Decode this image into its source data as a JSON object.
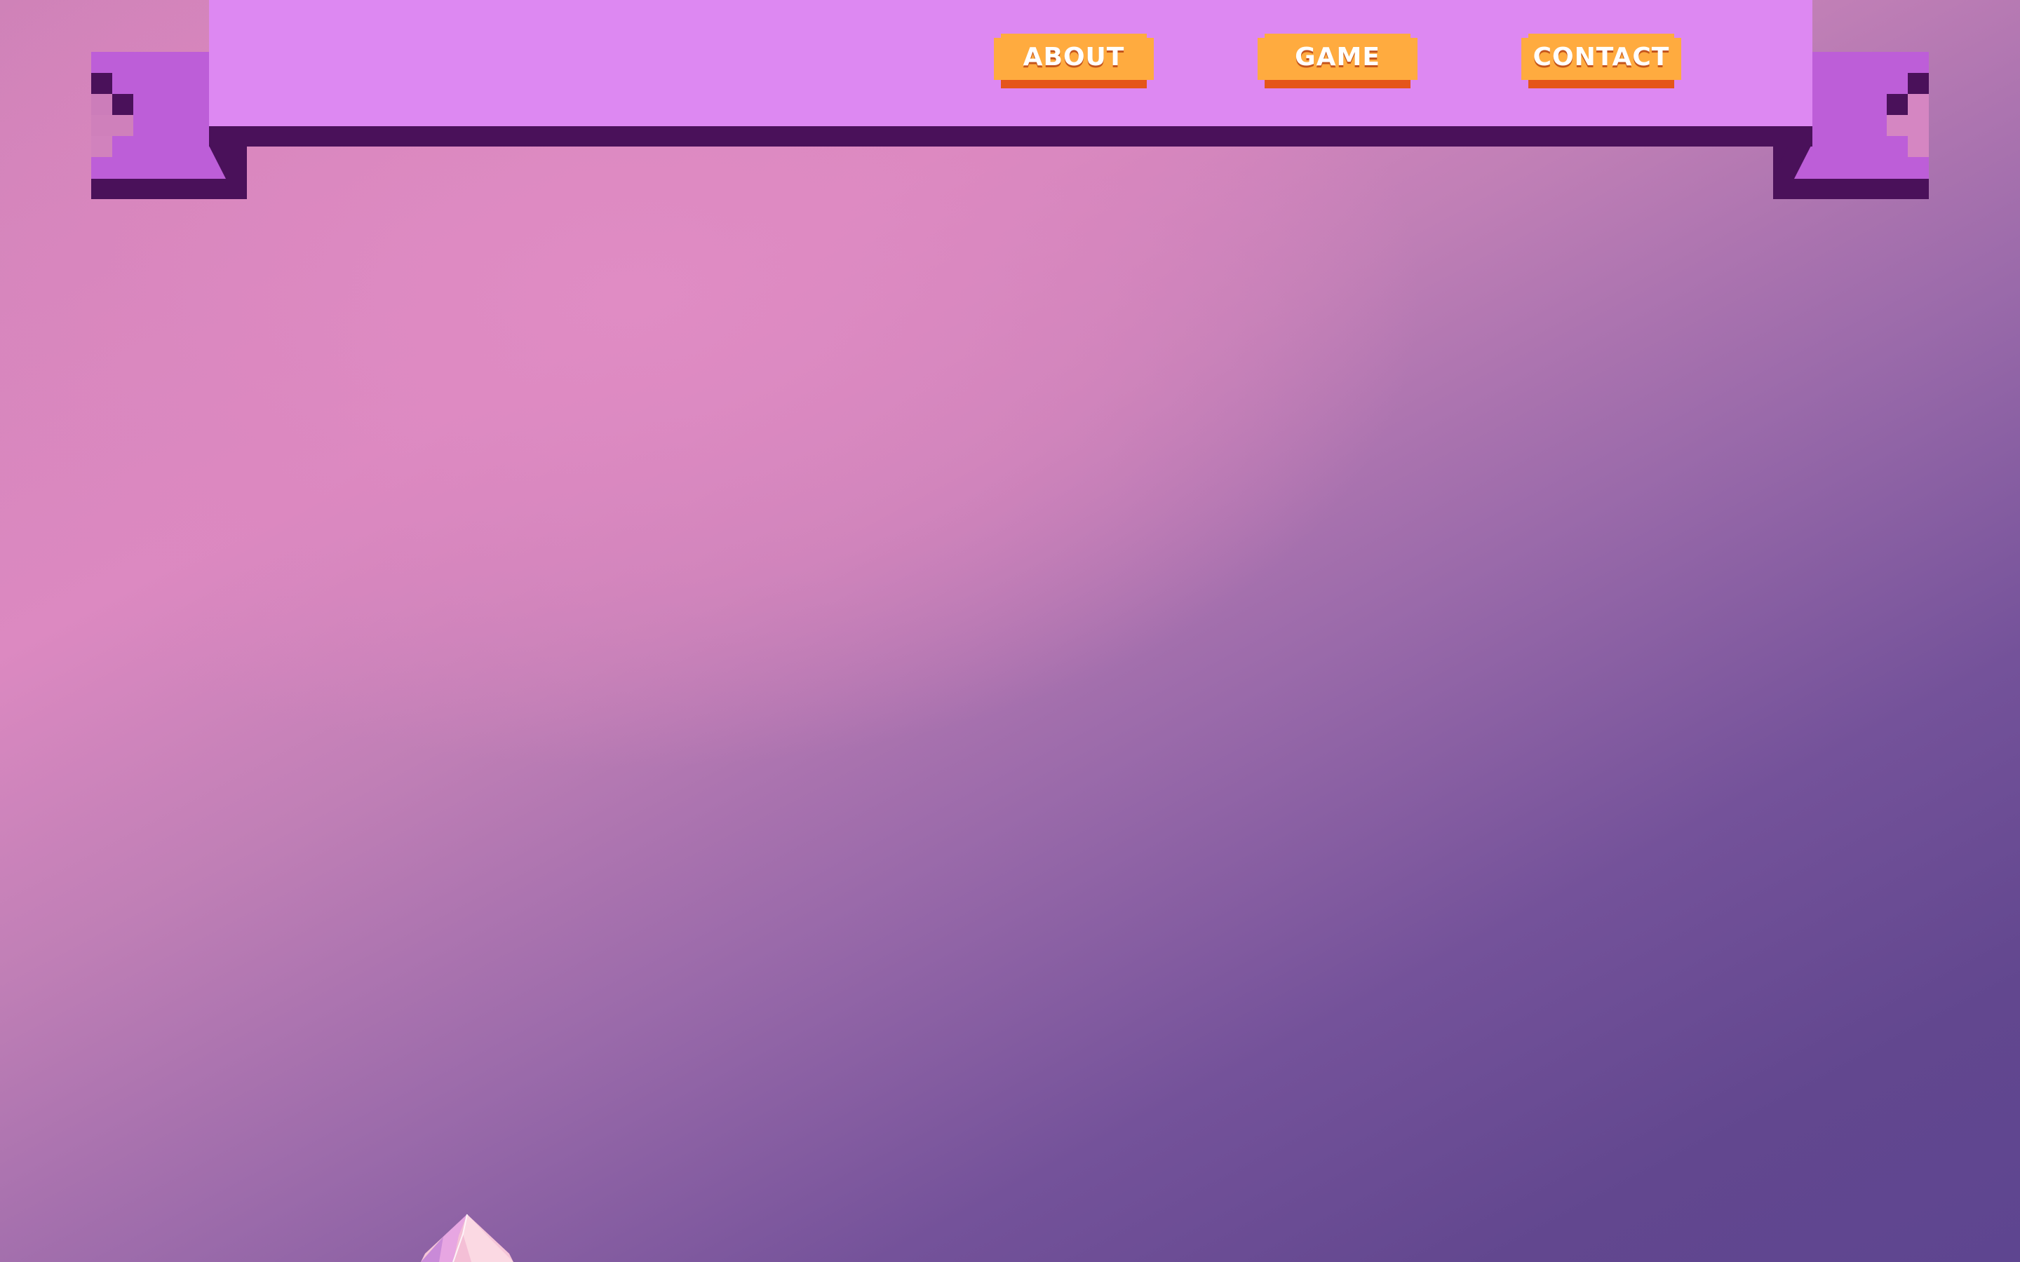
{
  "nav": {
    "items": [
      {
        "label": "ABOUT"
      },
      {
        "label": "GAME"
      },
      {
        "label": "CONTACT"
      }
    ]
  },
  "colors": {
    "banner": "#dd88f2",
    "banner_shadow": "#4a115a",
    "ribbon": "#bd5ed8",
    "button_face": "#ffab3f",
    "button_shadow": "#e5551a",
    "bg_top": "#dc89c1",
    "bg_bottom": "#5e4590"
  },
  "icons": {
    "crystal": "pink-crystal-icon"
  }
}
